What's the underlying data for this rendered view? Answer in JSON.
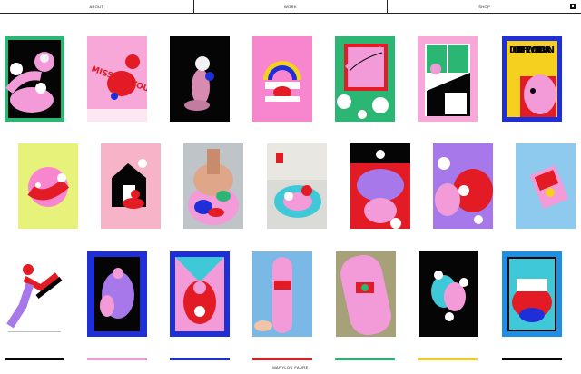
{
  "nav": {
    "items": [
      {
        "label": "ABOUT"
      },
      {
        "label": "WORK"
      },
      {
        "label": "SHOP"
      }
    ],
    "cart_icon": "cart-icon"
  },
  "gallery": {
    "row1": [
      {
        "name": "artwork-reclining-woman",
        "bg": "#2bb673"
      },
      {
        "name": "artwork-missing-you-all",
        "bg": "#f7a8d8",
        "text": "MISSING YOU ALL"
      },
      {
        "name": "artwork-flower-figure-dark",
        "bg": "#050505"
      },
      {
        "name": "artwork-rainbow-hands",
        "bg": "#f786cf"
      },
      {
        "name": "artwork-window-arm",
        "bg": "#2bb673"
      },
      {
        "name": "artwork-window-plant",
        "bg": "#f7a8d8"
      },
      {
        "name": "artwork-dont-let-the-world-burn",
        "bg": "#1f2fd8",
        "text": "DON'T LET THE WORLD BURN"
      }
    ],
    "row2": [
      {
        "name": "artwork-yellow-circle",
        "bg": "#e7f27a"
      },
      {
        "name": "artwork-house-figure",
        "bg": "#f7b3c8"
      },
      {
        "name": "artwork-guitar-painting",
        "bg": "#bfc4c8"
      },
      {
        "name": "artwork-skateboard-ceramic",
        "bg": "#dadbd6"
      },
      {
        "name": "artwork-red-bodies",
        "bg": "#e21b24"
      },
      {
        "name": "artwork-purple-flowers",
        "bg": "#a678ea"
      },
      {
        "name": "artwork-card-blue",
        "bg": "#8ec9ee"
      }
    ],
    "row3": [
      {
        "name": "artwork-flying-figure",
        "bg": "#ffffff"
      },
      {
        "name": "artwork-blue-phone",
        "bg": "#1f2fd8"
      },
      {
        "name": "artwork-blue-triple",
        "bg": "#1f2fd8"
      },
      {
        "name": "artwork-skate-deck-sky",
        "bg": "#7ab8e6"
      },
      {
        "name": "artwork-skate-deck-hand",
        "bg": "#a7a17a"
      },
      {
        "name": "artwork-black-flowers",
        "bg": "#050505"
      },
      {
        "name": "artwork-blue-sofa",
        "bg": "#1f8fe6"
      }
    ]
  },
  "footer": {
    "credit": "MARYLOU FAURE"
  }
}
